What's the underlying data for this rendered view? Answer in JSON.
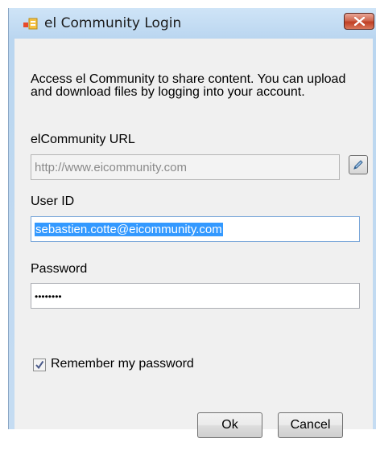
{
  "window": {
    "title": "el Community Login",
    "close_icon": "close-x-icon",
    "app_icon": "login-window-icon"
  },
  "description": "Access el Community to share content.  You can upload and download files by logging into your account.",
  "url_field": {
    "label": "elCommunity URL",
    "value": "http://www.eicommunity.com",
    "disabled": true,
    "edit_icon": "pencil-edit-icon"
  },
  "user_field": {
    "label": "User ID",
    "value": "sebastien.cotte@eicommunity.com"
  },
  "password_field": {
    "label": "Password",
    "value": "••••••••"
  },
  "remember": {
    "label": "Remember my password",
    "checked": true
  },
  "buttons": {
    "ok": "Ok",
    "cancel": "Cancel"
  },
  "colors": {
    "selection": "#3399ff",
    "close_button": "#c03f24",
    "window_frame": "#bad6f0"
  }
}
